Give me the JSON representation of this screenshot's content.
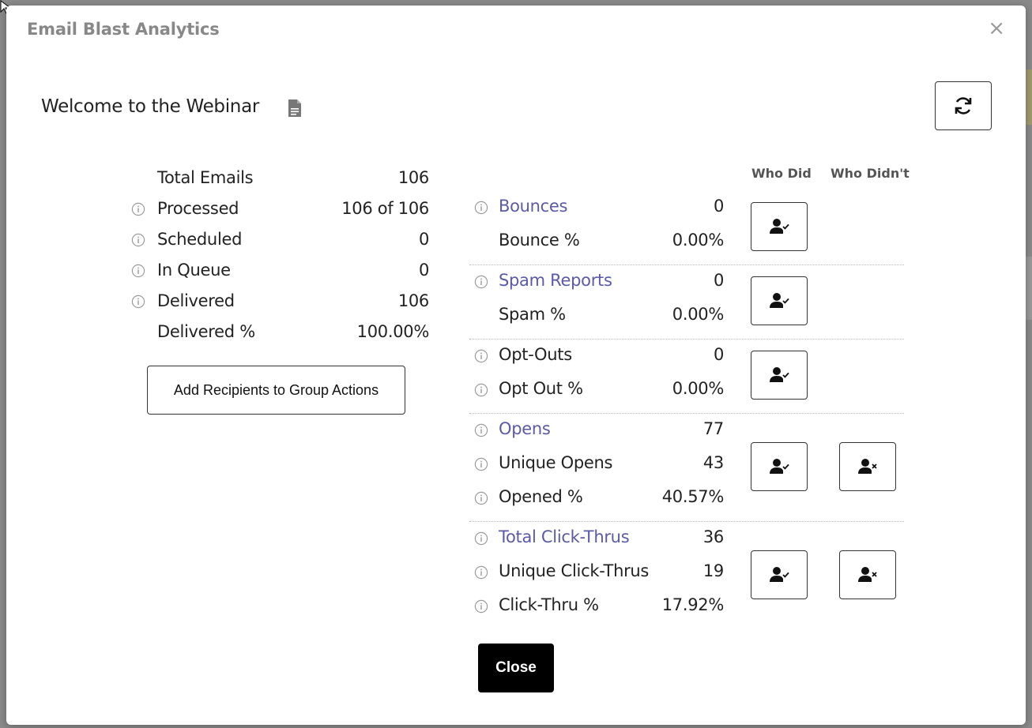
{
  "modal": {
    "title": "Email Blast Analytics",
    "close_x": "×",
    "blast_name": "Welcome to the Webinar"
  },
  "left_stats": [
    {
      "label": "Total Emails",
      "value": "106",
      "info": false
    },
    {
      "label": "Processed",
      "value": "106 of 106",
      "info": true
    },
    {
      "label": "Scheduled",
      "value": "0",
      "info": true
    },
    {
      "label": "In Queue",
      "value": "0",
      "info": true
    },
    {
      "label": "Delivered",
      "value": "106",
      "info": true
    },
    {
      "label": "Delivered %",
      "value": "100.00%",
      "info": false
    }
  ],
  "add_recipients_label": "Add Recipients to Group Actions",
  "columns": {
    "who_did": "Who Did",
    "who_didnt": "Who Didn't"
  },
  "groups": [
    {
      "rows": [
        {
          "label": "Bounces",
          "value": "0",
          "info": true,
          "link": true
        },
        {
          "label": "Bounce %",
          "value": "0.00%",
          "info": false,
          "link": false
        }
      ],
      "who_did": true,
      "who_didnt": false
    },
    {
      "rows": [
        {
          "label": "Spam Reports",
          "value": "0",
          "info": true,
          "link": true
        },
        {
          "label": "Spam %",
          "value": "0.00%",
          "info": false,
          "link": false
        }
      ],
      "who_did": true,
      "who_didnt": false
    },
    {
      "rows": [
        {
          "label": "Opt-Outs",
          "value": "0",
          "info": true,
          "link": false
        },
        {
          "label": "Opt Out %",
          "value": "0.00%",
          "info": true,
          "link": false
        }
      ],
      "who_did": true,
      "who_didnt": false
    },
    {
      "rows": [
        {
          "label": "Opens",
          "value": "77",
          "info": true,
          "link": true
        },
        {
          "label": "Unique Opens",
          "value": "43",
          "info": true,
          "link": false
        },
        {
          "label": "Opened %",
          "value": "40.57%",
          "info": true,
          "link": false
        }
      ],
      "who_did": true,
      "who_didnt": true
    },
    {
      "rows": [
        {
          "label": "Total Click-Thrus",
          "value": "36",
          "info": true,
          "link": true
        },
        {
          "label": "Unique Click-Thrus",
          "value": "19",
          "info": true,
          "link": false
        },
        {
          "label": "Click-Thru %",
          "value": "17.92%",
          "info": true,
          "link": false
        }
      ],
      "who_did": true,
      "who_didnt": true
    }
  ],
  "close_label": "Close",
  "colors": {
    "link": "#5a5aa8",
    "close_bg": "#000000"
  },
  "icons": {
    "refresh": "refresh-icon",
    "document": "document-icon",
    "info": "info-icon",
    "who_did": "user-check-icon",
    "who_didnt": "user-x-icon"
  }
}
